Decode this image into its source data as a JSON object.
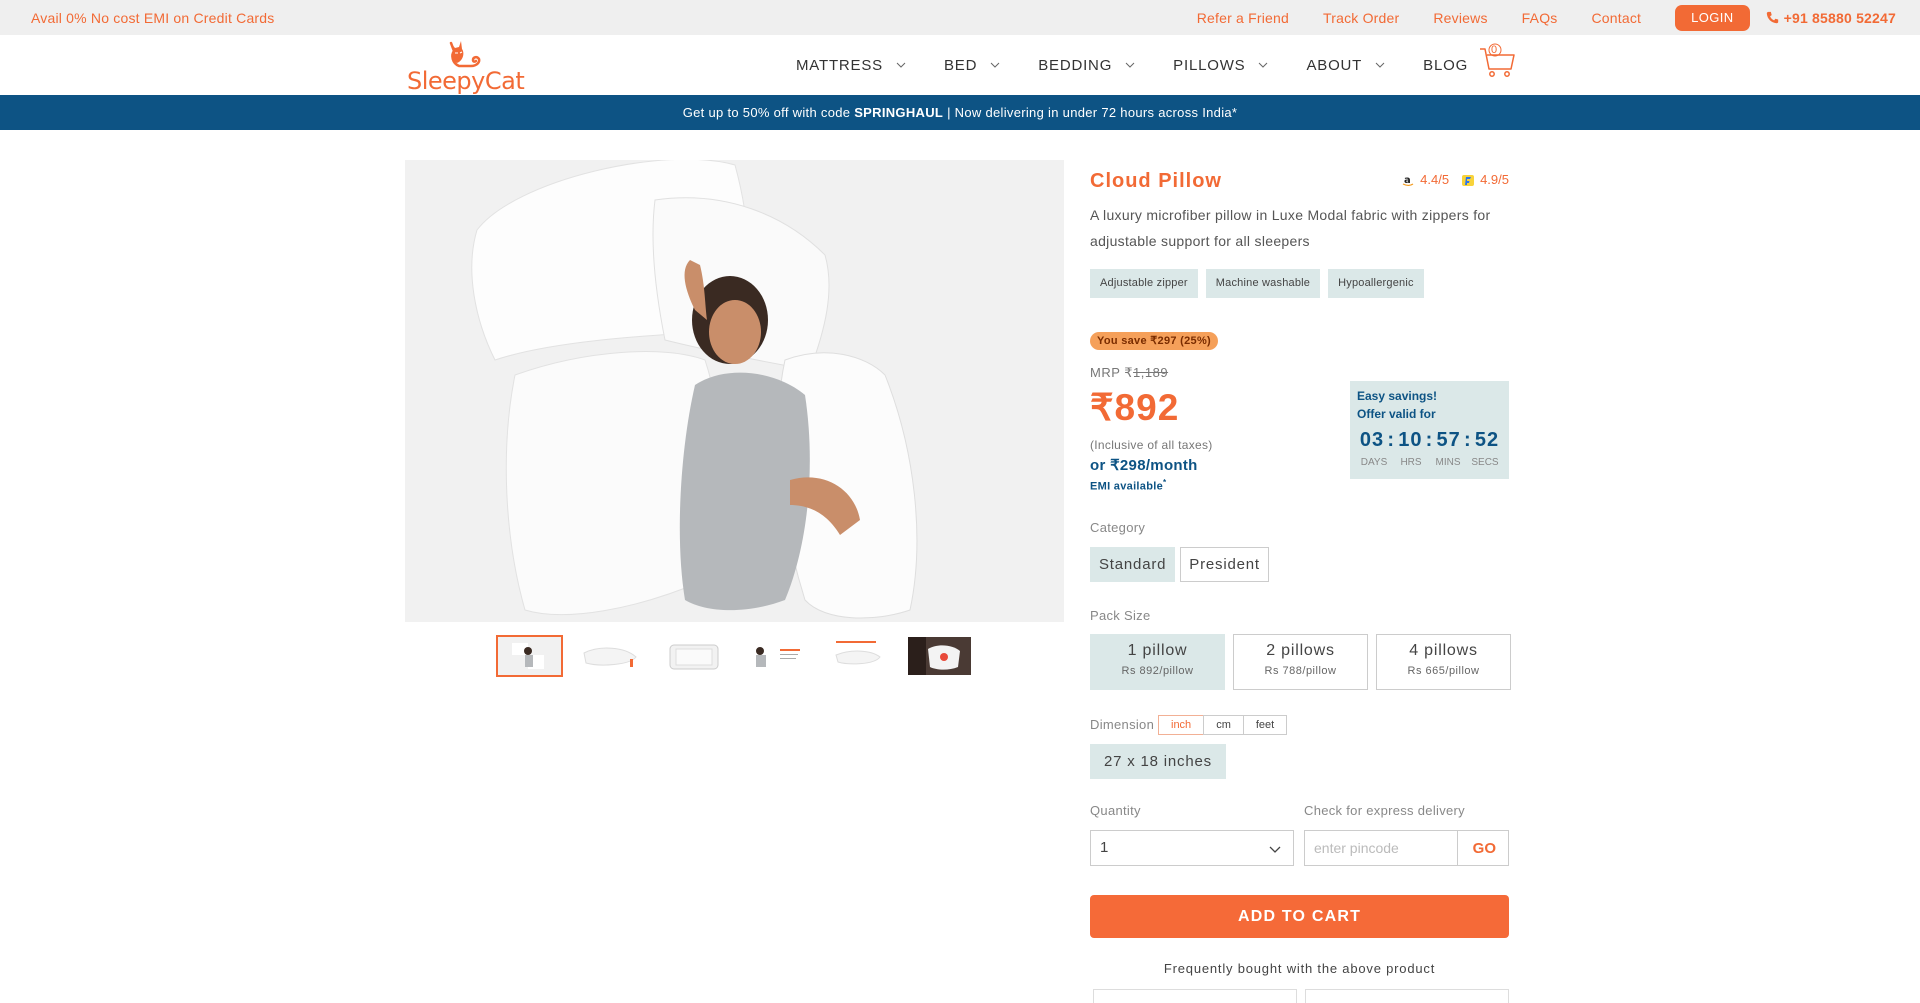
{
  "topbar": {
    "emi_text": "Avail 0% No cost EMI on Credit Cards",
    "links": [
      "Refer a Friend",
      "Track Order",
      "Reviews",
      "FAQs",
      "Contact"
    ],
    "login": "LOGIN",
    "phone": "+91 85880 52247"
  },
  "header": {
    "logo_text": "SleepyCat",
    "nav": [
      "MATTRESS",
      "BED",
      "BEDDING",
      "PILLOWS",
      "ABOUT",
      "BLOG"
    ],
    "cart_count": "0"
  },
  "promo": {
    "before": "Get up to 50% off with code ",
    "code": "SPRINGHAUL",
    "after": " | Now delivering in under 72 hours across India*"
  },
  "product": {
    "title": "Cloud Pillow",
    "rating_amazon": "4.4/5",
    "rating_flipkart": "4.9/5",
    "description": "A luxury microfiber pillow in Luxe Modal fabric with zippers for adjustable support for all sleepers",
    "chips": [
      "Adjustable zipper",
      "Machine washable",
      "Hypoallergenic"
    ],
    "save": "You save ₹297 (25%)",
    "mrp_label": "MRP ₹",
    "mrp_value": "1,189",
    "price": "₹892",
    "inclusive": "(Inclusive of all taxes)",
    "emi_price": "or ₹298/month",
    "emi_available": "EMI available",
    "emi_star": "*"
  },
  "timer": {
    "line1": "Easy savings!",
    "line2": "Offer valid for",
    "days": "03",
    "hrs": "10",
    "mins": "57",
    "secs": "52",
    "labels": [
      "DAYS",
      "HRS",
      "MINS",
      "SECS"
    ]
  },
  "category": {
    "label": "Category",
    "options": [
      "Standard",
      "President"
    ],
    "selected": "Standard"
  },
  "pack": {
    "label": "Pack Size",
    "options": [
      {
        "name": "1 pillow",
        "price": "Rs 892/pillow"
      },
      {
        "name": "2 pillows",
        "price": "Rs 788/pillow"
      },
      {
        "name": "4 pillows",
        "price": "Rs 665/pillow"
      }
    ]
  },
  "dimension": {
    "label": "Dimension",
    "units": [
      "inch",
      "cm",
      "feet"
    ],
    "selected_unit": "inch",
    "value": "27 x 18 inches"
  },
  "quantity": {
    "label": "Quantity",
    "value": "1"
  },
  "delivery": {
    "label": "Check for express delivery",
    "placeholder": "enter pincode",
    "go": "GO"
  },
  "add_to_cart": "ADD TO CART",
  "fbt": "Frequently bought with the above product",
  "colors": {
    "accent": "#f26a35",
    "navy": "#0d5384",
    "chip_bg": "#dbe8e8"
  }
}
